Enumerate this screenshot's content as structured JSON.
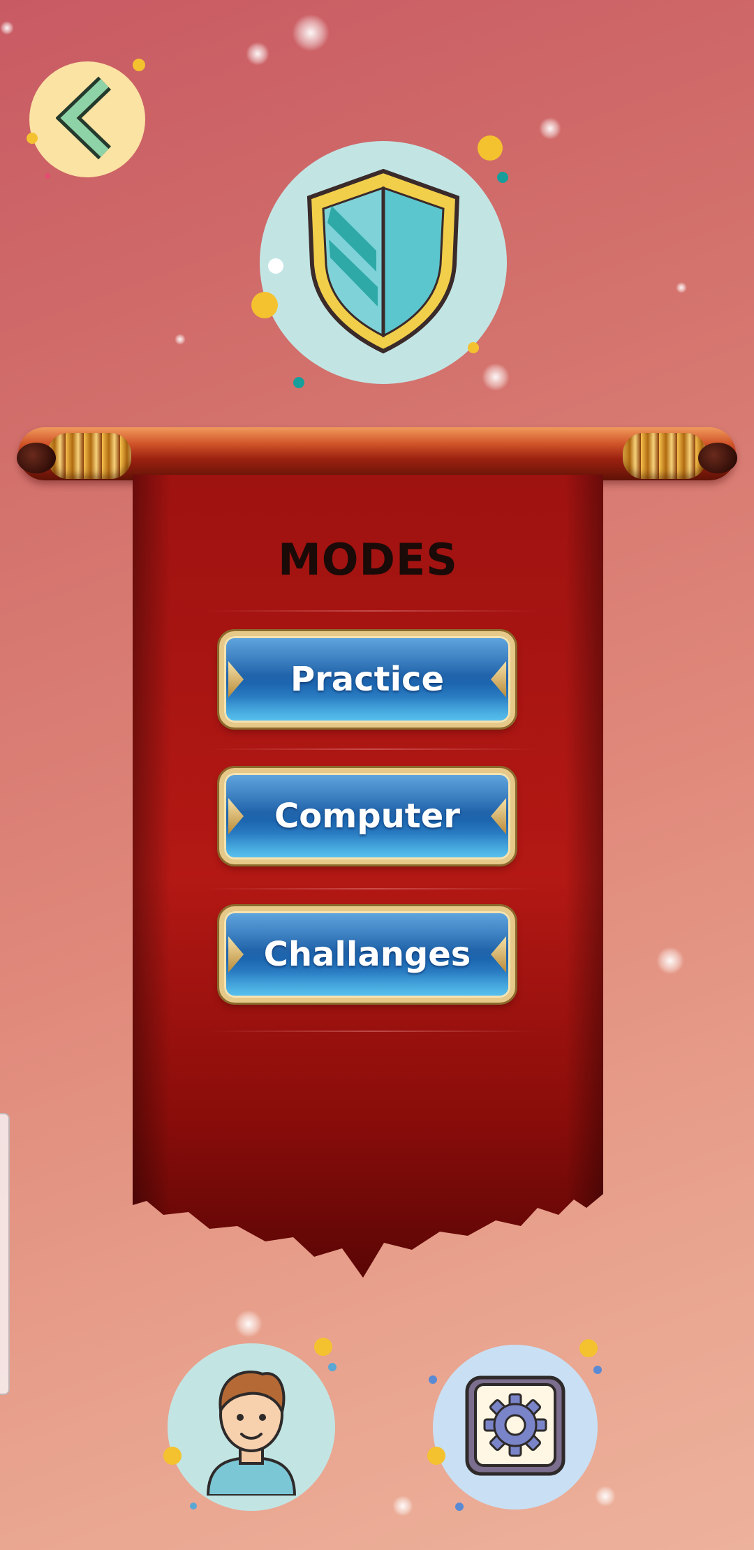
{
  "screen": {
    "title": "MODES"
  },
  "modes": [
    {
      "label": "Practice"
    },
    {
      "label": "Computer"
    },
    {
      "label": "Challanges"
    }
  ],
  "icons": {
    "back": "chevron-left-icon",
    "emblem": "shield-icon",
    "profile": "user-avatar-icon",
    "settings": "gear-icon"
  },
  "colors": {
    "button_blue": "#1a5fa8",
    "button_border": "#e6c989",
    "banner_red": "#a5120f",
    "shield_teal": "#5cc6cf",
    "shield_gold": "#f2cf4a"
  }
}
